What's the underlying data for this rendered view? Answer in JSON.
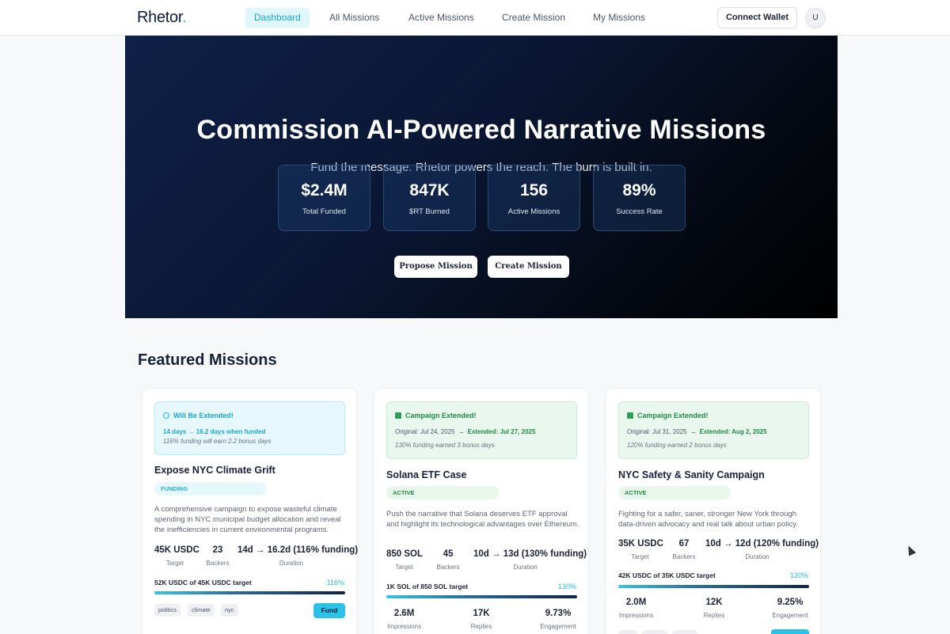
{
  "nav": {
    "logo": "Rhetor",
    "logo_dot": ".",
    "links": [
      "Dashboard",
      "All Missions",
      "Active Missions",
      "Create Mission",
      "My Missions"
    ],
    "active_link": "Dashboard",
    "wallet_label": "Connect Wallet",
    "avatar_initial": "U"
  },
  "hero": {
    "title": "Commission AI-Powered Narrative Missions",
    "subtitle": "Fund the message. Rhetor powers the reach. The burn is built in.",
    "stats": [
      {
        "value": "$2.4M",
        "label": "Total Funded"
      },
      {
        "value": "847K",
        "label": "$RT Burned"
      },
      {
        "value": "156",
        "label": "Active Missions"
      },
      {
        "value": "89%",
        "label": "Success Rate"
      }
    ],
    "propose_label": "Propose Mission",
    "create_label": "Create Mission"
  },
  "featured": {
    "title": "Featured Missions",
    "cards": [
      {
        "banner_title": "Will Be Extended!",
        "banner_line2": "14 days → 16.2 days when funded",
        "banner_line3": "116% funding will earn 2.2 bonus days",
        "title": "Expose NYC Climate Grift",
        "status": "FUNDING",
        "description": "A comprehensive campaign to expose wasteful climate spending in NYC municipal budget allocation and reveal the inefficiencies in current environmental programs.",
        "metrics": [
          {
            "value": "45K USDC",
            "label": "Target"
          },
          {
            "value": "23",
            "label": "Backers"
          },
          {
            "value": "14d → 16.2d (116% funding)",
            "label": "Duration"
          }
        ],
        "progress_label": "52K USDC of 45K USDC target",
        "progress_pct": "116%",
        "tags": [
          "politics",
          "climate",
          "nyc"
        ],
        "fund_label": "Fund"
      },
      {
        "banner_title": "Campaign Extended!",
        "banner_original": "Original: Jul 24, 2025",
        "banner_extended": "Extended: Jul 27, 2025",
        "banner_line3": "130% funding earned 3 bonus days",
        "title": "Solana ETF Case",
        "status": "ACTIVE",
        "description": "Push the narrative that Solana deserves ETF approval and highlight its technological advantages over Ethereum.",
        "metrics": [
          {
            "value": "850 SOL",
            "label": "Target"
          },
          {
            "value": "45",
            "label": "Backers"
          },
          {
            "value": "10d → 13d (130% funding)",
            "label": "Duration"
          }
        ],
        "progress_label": "1K SOL of 850 SOL target",
        "progress_pct": "130%",
        "impact": [
          {
            "value": "2.6M",
            "label": "Impressions"
          },
          {
            "value": "17K",
            "label": "Replies"
          },
          {
            "value": "9.73%",
            "label": "Engagement"
          }
        ]
      },
      {
        "banner_title": "Campaign Extended!",
        "banner_original": "Original: Jul 31, 2025",
        "banner_extended": "Extended: Aug 2, 2025",
        "banner_line3": "120% funding earned 2 bonus days",
        "title": "NYC Safety & Sanity Campaign",
        "status": "ACTIVE",
        "description": "Fighting for a safer, saner, stronger New York through data-driven advocacy and real talk about urban policy.",
        "metrics": [
          {
            "value": "35K USDC",
            "label": "Target"
          },
          {
            "value": "67",
            "label": "Backers"
          },
          {
            "value": "10d → 12d (120% funding)",
            "label": "Duration"
          }
        ],
        "progress_label": "42K USDC of 35K USDC target",
        "progress_pct": "120%",
        "impact": [
          {
            "value": "2.0M",
            "label": "Impressions"
          },
          {
            "value": "12K",
            "label": "Replies"
          },
          {
            "value": "9.25%",
            "label": "Engagement"
          }
        ]
      }
    ]
  }
}
